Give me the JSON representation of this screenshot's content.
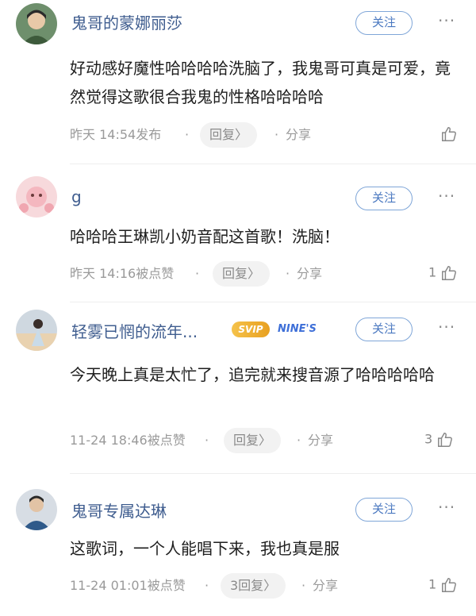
{
  "comments": [
    {
      "username": "鬼哥的蒙娜丽莎",
      "follow_label": "关注",
      "more": "···",
      "content": "好动感好魔性哈哈哈哈洗脑了，我鬼哥可真是可爱，竟然觉得这歌很合我鬼的性格哈哈哈哈",
      "time": "昨天 14:54发布",
      "reply_label": "回复〉",
      "share_label": "分享",
      "likes": ""
    },
    {
      "username": "g",
      "follow_label": "关注",
      "more": "···",
      "content": "哈哈哈王琳凯小奶音配这首歌！洗脑！",
      "time": "昨天 14:16被点赞",
      "reply_label": "回复〉",
      "share_label": "分享",
      "likes": "1"
    },
    {
      "username": "轻雾已惘的流年...",
      "badges": [
        "SVIP",
        "NINE'S"
      ],
      "follow_label": "关注",
      "more": "···",
      "content": "今天晚上真是太忙了，追完就来搜音源了哈哈哈哈哈",
      "time": "11-24 18:46被点赞",
      "reply_label": "回复〉",
      "share_label": "分享",
      "likes": "3"
    },
    {
      "username": "鬼哥专属达琳",
      "follow_label": "关注",
      "more": "···",
      "content": "这歌词，一个人能唱下来，我也真是服",
      "time": "11-24 01:01被点赞",
      "reply_label": "3回复〉",
      "share_label": "分享",
      "likes": "1"
    }
  ],
  "dot": "·",
  "colors": {
    "username": "#3f5d8f",
    "follow": "#4a78c0",
    "meta": "#9a9a9a"
  }
}
